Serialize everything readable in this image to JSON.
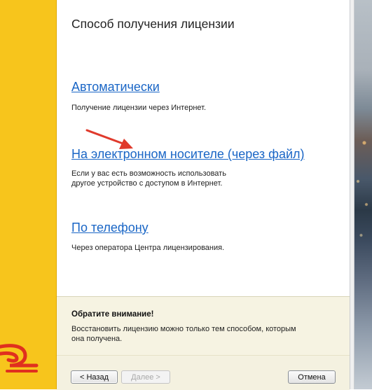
{
  "window": {
    "title": "Способ получения лицензии"
  },
  "options": [
    {
      "label": "Автоматически",
      "description": "Получение лицензии через Интернет."
    },
    {
      "label": "На электронном носителе (через файл)",
      "description_lines": [
        "Если у вас есть возможность использовать",
        "другое устройство с доступом в Интернет."
      ]
    },
    {
      "label": "По телефону",
      "description": "Через оператора Центра лицензирования."
    }
  ],
  "notice": {
    "title": "Обратите внимание!",
    "lines": [
      "Восстановить лицензию можно только тем способом, которым",
      "она получена."
    ]
  },
  "buttons": {
    "back": "< Назад",
    "next": "Далее >",
    "cancel": "Отмена"
  },
  "colors": {
    "brand_yellow": "#f7c51c",
    "brand_red": "#e0301e",
    "link_blue": "#1a66c6",
    "arrow_red": "#e03a2c",
    "notice_bg": "#f6f3e2"
  },
  "icons": {
    "logo": "1c-logo-icon",
    "annotation_arrow": "arrow-icon"
  }
}
